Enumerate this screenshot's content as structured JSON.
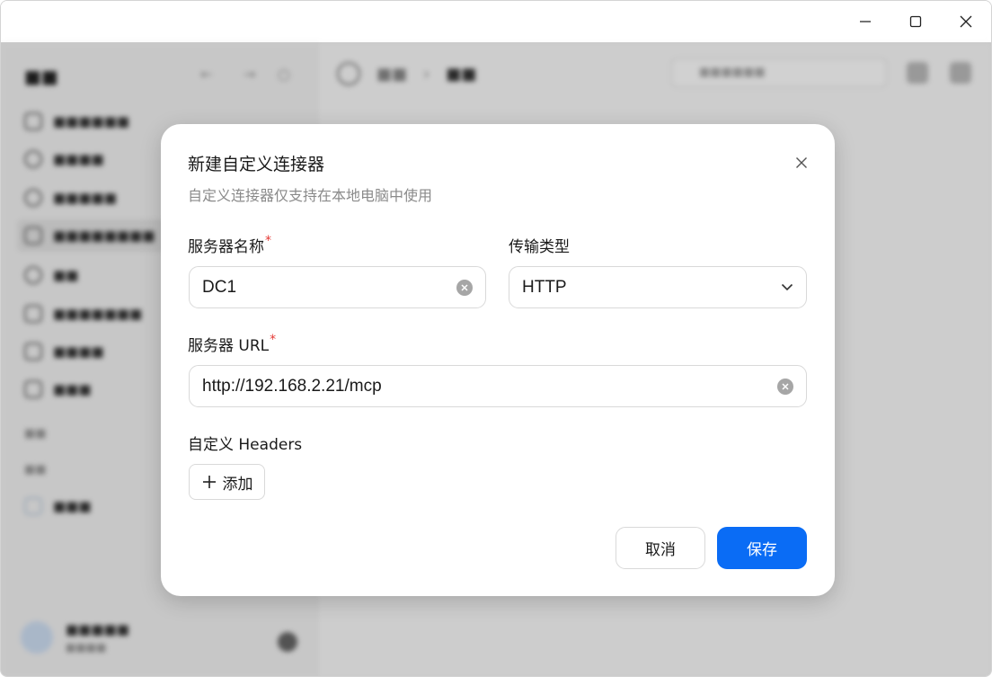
{
  "dialog": {
    "title": "新建自定义连接器",
    "subtitle": "自定义连接器仅支持在本地电脑中使用",
    "server_name": {
      "label": "服务器名称",
      "required_mark": "*",
      "value": "DC1"
    },
    "transport": {
      "label": "传输类型",
      "value": "HTTP"
    },
    "server_url": {
      "label": "服务器 URL",
      "required_mark": "*",
      "value": "http://192.168.2.21/mcp"
    },
    "headers": {
      "label": "自定义 Headers",
      "add_label": "添加"
    },
    "cancel_label": "取消",
    "save_label": "保存"
  },
  "colors": {
    "primary": "#0a6cf5",
    "required": "#e53935",
    "overlay": "#000000"
  }
}
